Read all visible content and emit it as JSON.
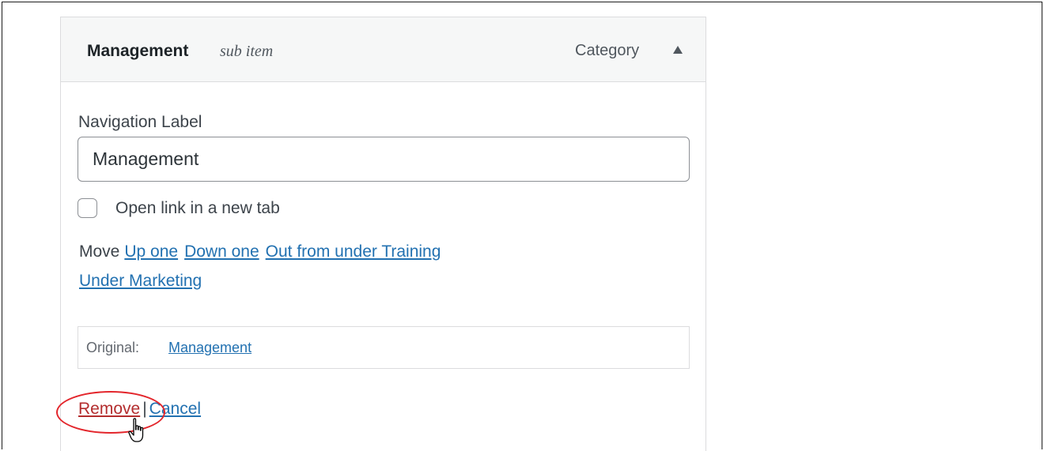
{
  "menu_item": {
    "title": "Management",
    "subtitle": "sub item",
    "type": "Category"
  },
  "settings": {
    "nav_label_label": "Navigation Label",
    "nav_label_value": "Management",
    "new_tab_label": "Open link in a new tab",
    "new_tab_checked": false
  },
  "move": {
    "label": "Move",
    "links": [
      "Up one",
      "Down one",
      "Out from under Training",
      "Under Marketing"
    ]
  },
  "original": {
    "label": "Original:",
    "link": "Management"
  },
  "actions": {
    "remove": "Remove",
    "separator": "|",
    "cancel": "Cancel"
  },
  "colors": {
    "link": "#2271b1",
    "delete": "#b32d2e",
    "highlight": "#e3262c"
  },
  "icons": {
    "toggle": "arrow-up-icon",
    "pointer": "hand-cursor-icon"
  }
}
